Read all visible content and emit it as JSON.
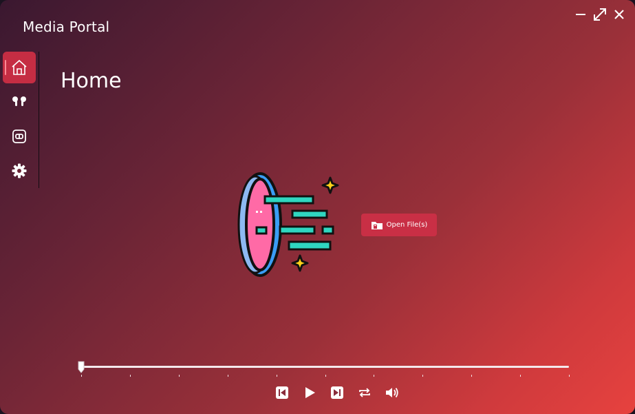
{
  "window": {
    "title": "Media Portal",
    "controls": [
      "minimize-icon",
      "maximize-icon",
      "close-icon"
    ]
  },
  "sidebar": {
    "items": [
      {
        "id": "home",
        "icon": "home-icon",
        "active": true
      },
      {
        "id": "music",
        "icon": "earbuds-icon",
        "active": false
      },
      {
        "id": "video",
        "icon": "video-icon",
        "active": false
      },
      {
        "id": "settings",
        "icon": "gear-icon",
        "active": false
      }
    ]
  },
  "main": {
    "heading": "Home",
    "open_button": {
      "label": "Open File(s)",
      "icon": "folder-icon"
    }
  },
  "player": {
    "progress": 0,
    "tick_count": 11,
    "controls": [
      "previous-icon",
      "play-icon",
      "next-icon",
      "repeat-icon",
      "volume-icon"
    ]
  },
  "colors": {
    "accent": "#c92f45",
    "gradient_start": "#3a1830",
    "gradient_end": "#e7423e"
  }
}
